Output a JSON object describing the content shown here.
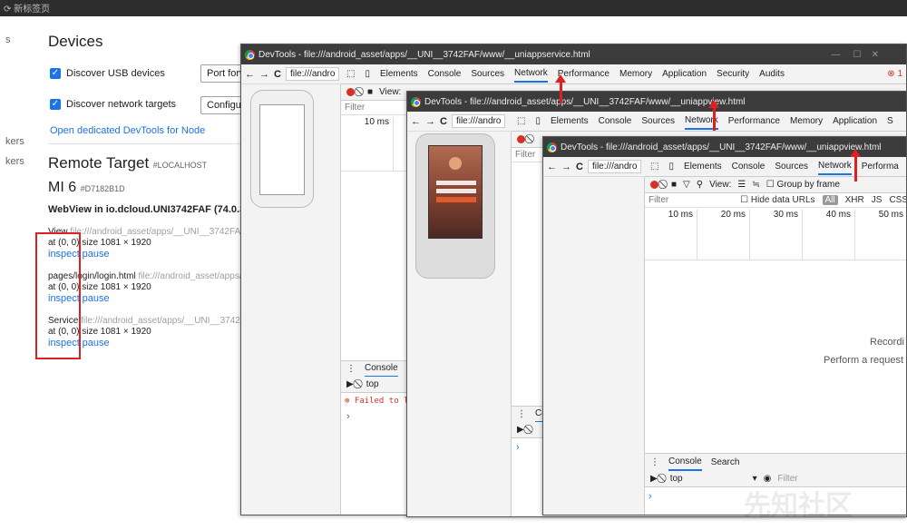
{
  "topbar": {
    "text": "⟳ 新标签页"
  },
  "inspect_page": {
    "side_s": "s",
    "side_kers1": "kers",
    "side_kers2": "kers",
    "devices_title": "Devices",
    "usb_label": "Discover USB devices",
    "usb_button": "Port forw",
    "net_label": "Discover network targets",
    "net_button": "Configur",
    "node_link": "Open dedicated DevTools for Node",
    "remote_title": "Remote Target",
    "remote_tag": "#LOCALHOST",
    "device_name": "MI 6",
    "device_id": "#D7182B1D",
    "webview_title": "WebView in io.dcloud.UNI3742FAF (74.0.37",
    "targets": [
      {
        "name": "View",
        "url": "file:///android_asset/apps/__UNI__3742FAF/w",
        "pos": "at (0, 0)  size 1081 × 1920",
        "inspect": "inspect",
        "pause": "pause"
      },
      {
        "name": "pages/login/login.html",
        "url": "file:///android_asset/apps/_",
        "pos": "at (0, 0)  size 1081 × 1920",
        "inspect": "inspect",
        "pause": "pause"
      },
      {
        "name": "Service",
        "url": "file:///android_asset/apps/__UNI__3742FAF",
        "pos": "at (0, 0)  size 1081 × 1920",
        "inspect": "inspect",
        "pause": "pause"
      }
    ]
  },
  "win1": {
    "title": "DevTools - file:///android_asset/apps/__UNI__3742FAF/www/__uniappservice.html",
    "url": "file:///andro",
    "tabs": [
      "Elements",
      "Console",
      "Sources",
      "Network",
      "Performance",
      "Memory",
      "Application",
      "Security",
      "Audits"
    ],
    "active_tab": "Network",
    "error_count": "1",
    "toolbar_text": "View:",
    "filter": "Filter",
    "time": "10 ms",
    "console_tab": "Console",
    "console_context": "top",
    "console_error": "Failed to lo",
    "prompt": "›"
  },
  "win2": {
    "title": "DevTools - file:///android_asset/apps/__UNI__3742FAF/www/__uniappview.html",
    "url": "file:///andro",
    "tabs": [
      "Elements",
      "Console",
      "Sources",
      "Network",
      "Performance",
      "Memory",
      "Application",
      "S"
    ],
    "active_tab": "Network",
    "filter": "Filter",
    "console_tab": "Co",
    "prompt": "›"
  },
  "win3": {
    "title": "DevTools - file:///android_asset/apps/__UNI__3742FAF/www/__uniappview.html",
    "url": "file:///andro",
    "tabs": [
      "Elements",
      "Console",
      "Sources",
      "Network",
      "Performa"
    ],
    "active_tab": "Network",
    "view_label": "View:",
    "group_label": "Group by frame",
    "filter": "Filter",
    "hide_data_urls": "Hide data URLs",
    "filter_all": "All",
    "filter_xhr": "XHR",
    "filter_js": "JS",
    "filter_css": "CSS",
    "times": [
      "10 ms",
      "20 ms",
      "30 ms",
      "40 ms",
      "50 ms"
    ],
    "recording": "Recordi",
    "perform_hint": "Perform a request or",
    "console_tab": "Console",
    "search_tab": "Search",
    "console_context": "top",
    "console_filter": "Filter",
    "prompt": "›"
  },
  "watermark": "先知社区",
  "colors": {
    "accent": "#1a73e8",
    "annotation": "#e02020",
    "titlebar": "#3c3c3c"
  }
}
